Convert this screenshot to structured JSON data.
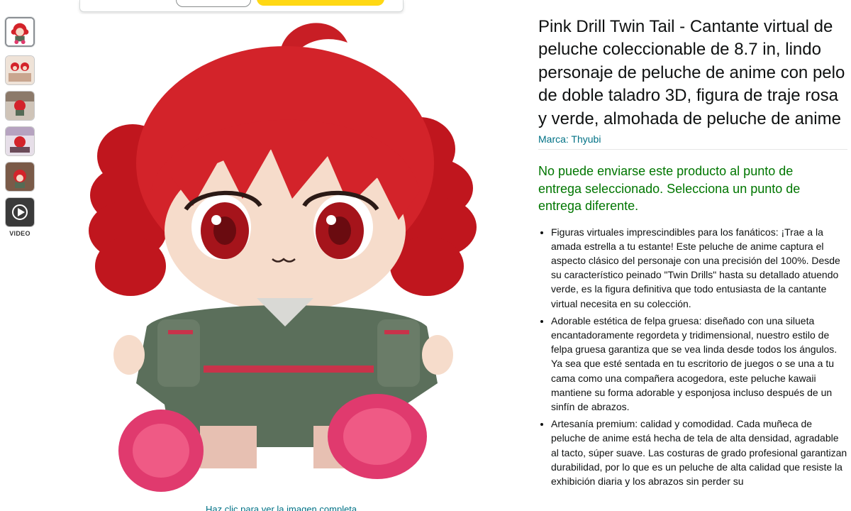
{
  "thumbnails": {
    "items": [
      {
        "icon": "product-thumbnail-main",
        "selected": true
      },
      {
        "icon": "product-thumbnail-2",
        "selected": false
      },
      {
        "icon": "product-thumbnail-3",
        "selected": false
      },
      {
        "icon": "product-thumbnail-4",
        "selected": false
      },
      {
        "icon": "product-thumbnail-5",
        "selected": false
      },
      {
        "icon": "video-thumbnail",
        "selected": false
      }
    ],
    "video_label": "VIDEO"
  },
  "image": {
    "bottom_link": "Haz clic para ver la imagen completa"
  },
  "product": {
    "title": "Pink Drill Twin Tail - Cantante virtual de peluche coleccionable de 8.7 in, lindo personaje de peluche de anime con pelo de doble taladro 3D, figura de traje rosa y verde, almohada de peluche de anime",
    "brand": "Marca: Thyubi",
    "availability": "No puede enviarse este producto al punto de entrega seleccionado. Selecciona un punto de entrega diferente.",
    "bullets": [
      "Figuras virtuales imprescindibles para los fanáticos: ¡Trae a la amada estrella a tu estante! Este peluche de anime captura el aspecto clásico del personaje con una precisión del 100%. Desde su característico peinado \"Twin Drills\" hasta su detallado atuendo verde, es la figura definitiva que todo entusiasta de la cantante virtual necesita en su colección.",
      "Adorable estética de felpa gruesa: diseñado con una silueta encantadoramente regordeta y tridimensional, nuestro estilo de felpa gruesa garantiza que se vea linda desde todos los ángulos. Ya sea que esté sentada en tu escritorio de juegos o se una a tu cama como una compañera acogedora, este peluche kawaii mantiene su forma adorable y esponjosa incluso después de un sinfín de abrazos.",
      "Artesanía premium: calidad y comodidad. Cada muñeca de peluche de anime está hecha de tela de alta densidad, agradable al tacto, súper suave. Las costuras de grado profesional garantizan durabilidad, por lo que es un peluche de alta calidad que resiste la exhibición diaria y los abrazos sin perder su"
    ]
  },
  "colors": {
    "link": "#007185",
    "availability": "#007600",
    "hair": "#d3232a",
    "outfit": "#556b55",
    "shoes": "#e03a6e"
  }
}
